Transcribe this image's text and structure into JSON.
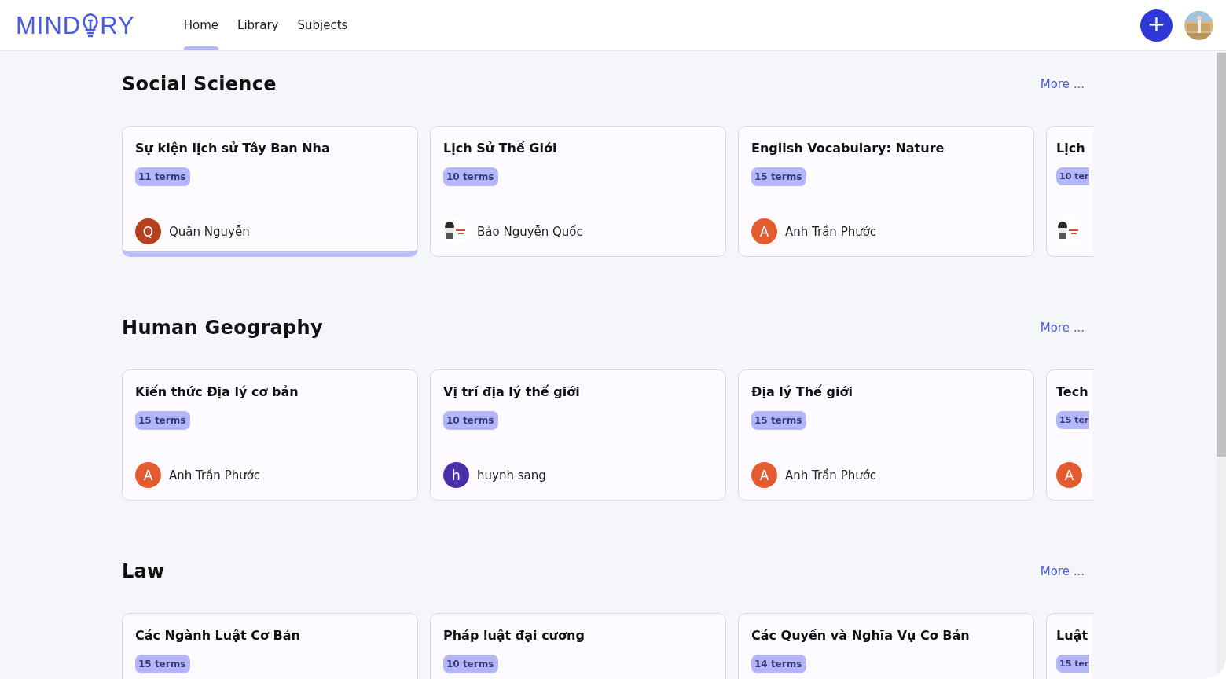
{
  "header": {
    "logo": {
      "before": "MIND",
      "after": "RY"
    },
    "nav": [
      {
        "label": "Home",
        "selected": true
      },
      {
        "label": "Library",
        "selected": false
      },
      {
        "label": "Subjects",
        "selected": false
      }
    ],
    "add_button": "+"
  },
  "sections": [
    {
      "title": "Social Science",
      "more": "More ...",
      "cards": [
        {
          "title": "Sự kiện lịch sử Tây Ban Nha",
          "terms": "11 terms",
          "selected": true,
          "partial": false,
          "author": {
            "kind": "letter",
            "initial": "Q",
            "color": "#b5401f",
            "name": "Quân Nguyễn"
          }
        },
        {
          "title": "Lịch Sử Thế Giới",
          "terms": "10 terms",
          "selected": false,
          "partial": false,
          "author": {
            "kind": "picture",
            "name": "Bảo Nguyễn Quốc"
          }
        },
        {
          "title": "English Vocabulary: Nature",
          "terms": "15 terms",
          "selected": false,
          "partial": false,
          "author": {
            "kind": "letter",
            "initial": "A",
            "color": "#e25c30",
            "name": "Anh Trần Phước"
          }
        },
        {
          "title": "Lịch",
          "terms": "10 ter",
          "selected": false,
          "partial": true
        }
      ]
    },
    {
      "title": "Human Geography",
      "more": "More ...",
      "cards": [
        {
          "title": "Kiến thức Địa lý cơ bản",
          "terms": "15 terms",
          "selected": false,
          "partial": false,
          "author": {
            "kind": "letter",
            "initial": "A",
            "color": "#e25c30",
            "name": "Anh Trần Phước"
          }
        },
        {
          "title": "Vị trí địa lý thế giới",
          "terms": "10 terms",
          "selected": false,
          "partial": false,
          "author": {
            "kind": "letter",
            "initial": "h",
            "color": "#4a2fa8",
            "name": "huynh sang"
          }
        },
        {
          "title": "Địa lý Thế giới",
          "terms": "15 terms",
          "selected": false,
          "partial": false,
          "author": {
            "kind": "letter",
            "initial": "A",
            "color": "#e25c30",
            "name": "Anh Trần Phước"
          }
        },
        {
          "title": "Tech",
          "terms": "15 ter",
          "selected": false,
          "partial": true,
          "author": {
            "kind": "letter",
            "initial": "A",
            "color": "#e25c30"
          }
        }
      ]
    },
    {
      "title": "Law",
      "more": "More ...",
      "cards": [
        {
          "title": "Các Ngành Luật Cơ Bản",
          "terms": "15 terms",
          "partial": false
        },
        {
          "title": "Pháp luật đại cương",
          "terms": "10 terms",
          "partial": false
        },
        {
          "title": "Các Quyền và Nghĩa Vụ Cơ Bản",
          "terms": "14 terms",
          "partial": false
        },
        {
          "title": "Luật",
          "terms": "15 ter",
          "partial": true
        }
      ]
    }
  ]
}
